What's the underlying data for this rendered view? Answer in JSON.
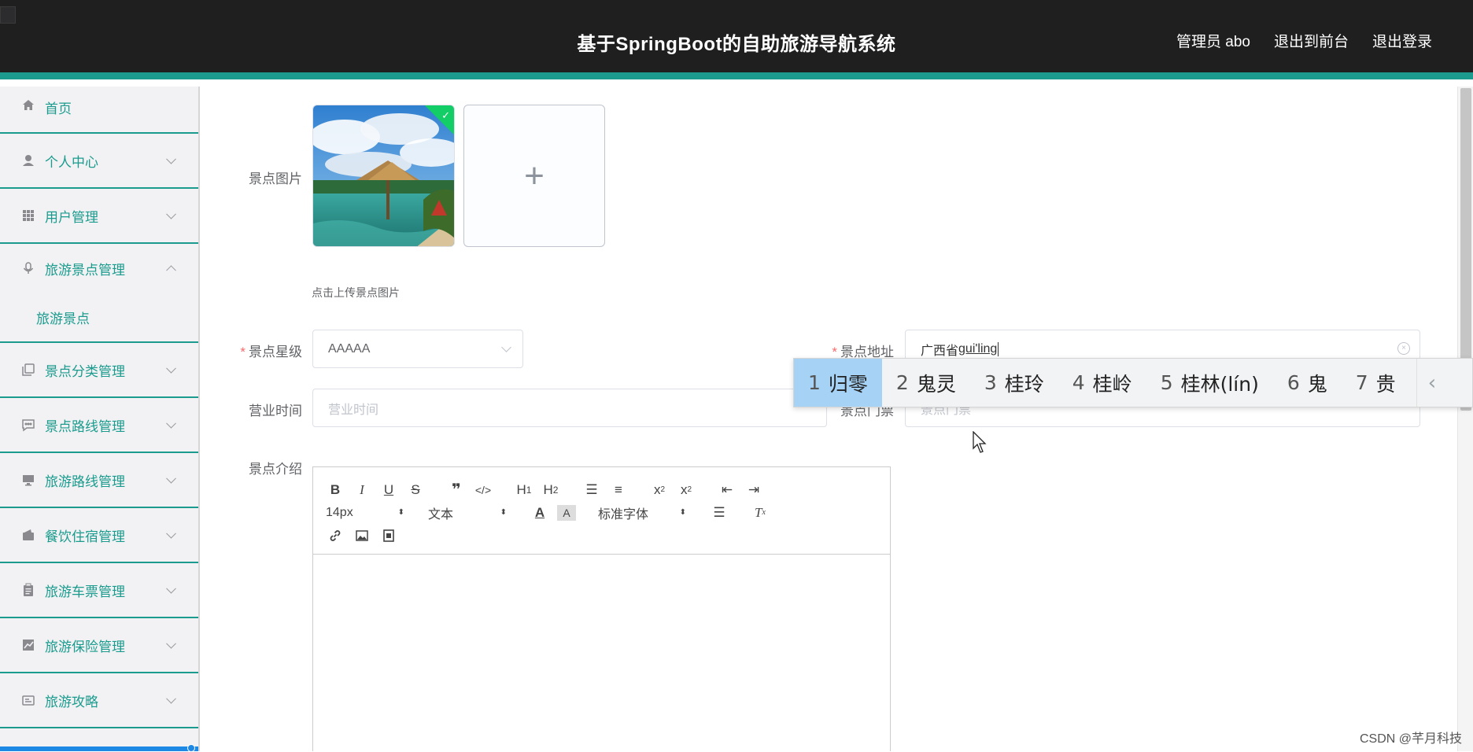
{
  "header": {
    "title": "基于SpringBoot的自助旅游导航系统",
    "user_label": "管理员 abo",
    "front_link": "退出到前台",
    "logout_link": "退出登录"
  },
  "sidebar": {
    "items": [
      {
        "label": "首页",
        "icon": "home-icon"
      },
      {
        "label": "个人中心",
        "icon": "user-icon"
      },
      {
        "label": "用户管理",
        "icon": "grid-icon"
      },
      {
        "label": "旅游景点管理",
        "icon": "microphone-icon",
        "expanded": true
      },
      {
        "label": "旅游景点",
        "sub": true
      },
      {
        "label": "景点分类管理",
        "icon": "copy-icon"
      },
      {
        "label": "景点路线管理",
        "icon": "chat-icon"
      },
      {
        "label": "旅游路线管理",
        "icon": "monitor-icon"
      },
      {
        "label": "餐饮住宿管理",
        "icon": "wallet-icon"
      },
      {
        "label": "旅游车票管理",
        "icon": "clipboard-icon"
      },
      {
        "label": "旅游保险管理",
        "icon": "chart-icon"
      },
      {
        "label": "旅游攻略",
        "icon": "card-icon"
      }
    ]
  },
  "form": {
    "image_label": "景点图片",
    "upload_hint": "点击上传景点图片",
    "level_label": "景点星级",
    "level_value": "AAAAA",
    "address_label": "景点地址",
    "address_value": "广西省",
    "address_composing": "gui'ling",
    "hours_label": "营业时间",
    "hours_placeholder": "营业时间",
    "ticket_label": "景点门票",
    "ticket_placeholder": "景点门票",
    "intro_label": "景点介绍"
  },
  "editor": {
    "font_size": "14px",
    "text_type": "文本",
    "font_family": "标准字体"
  },
  "ime": {
    "candidates": [
      {
        "n": "1",
        "text": "归零"
      },
      {
        "n": "2",
        "text": "鬼灵"
      },
      {
        "n": "3",
        "text": "桂玲"
      },
      {
        "n": "4",
        "text": "桂岭"
      },
      {
        "n": "5",
        "text": "桂林(lín)"
      },
      {
        "n": "6",
        "text": "鬼"
      },
      {
        "n": "7",
        "text": "贵"
      }
    ],
    "selected_index": 0
  },
  "watermark": "CSDN @芊月科技",
  "colors": {
    "accent": "#1a9b8d",
    "header_bg": "#1f1f20",
    "ime_selected": "#a6d3f5"
  }
}
